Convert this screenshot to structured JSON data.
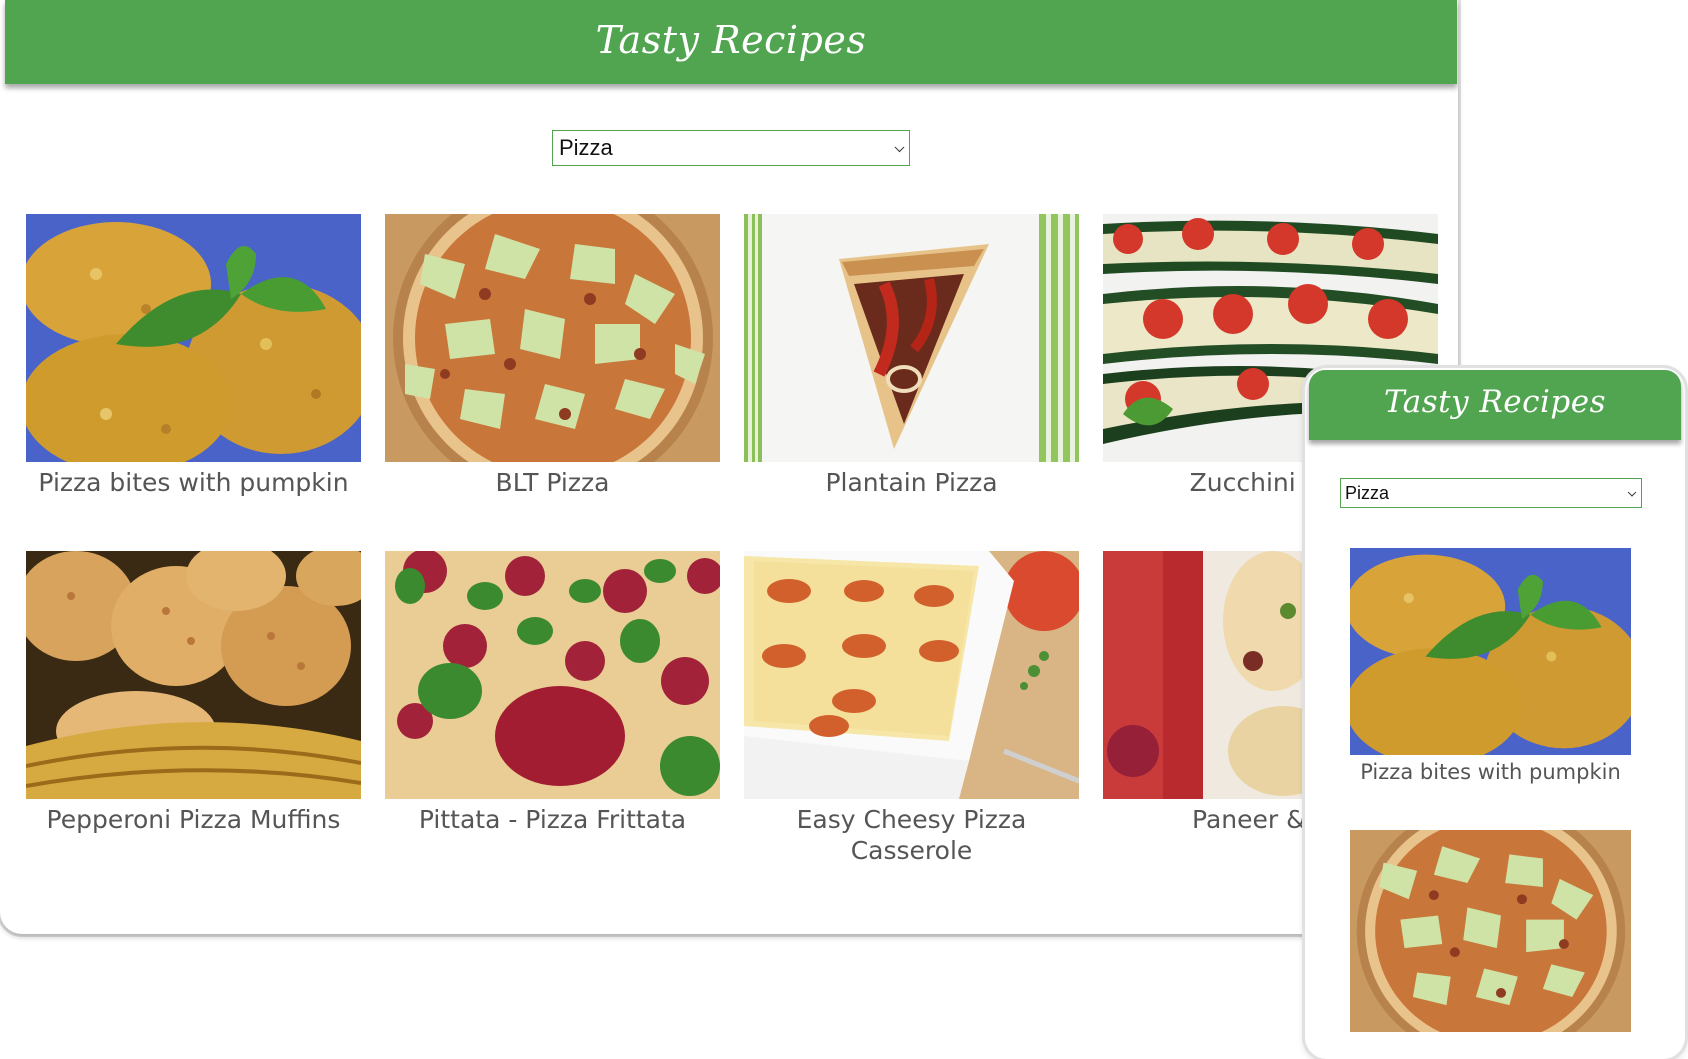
{
  "app": {
    "title": "Tasty Recipes"
  },
  "filter": {
    "selected": "Pizza"
  },
  "recipes": [
    {
      "title": "Pizza bites with pumpkin",
      "image": "pizza-bites-photo"
    },
    {
      "title": "BLT Pizza",
      "image": "blt-pizza-photo"
    },
    {
      "title": "Plantain Pizza",
      "image": "plantain-pizza-photo"
    },
    {
      "title": "Zucchini Pizz",
      "image": "zucchini-pizza-photo"
    },
    {
      "title": "Pepperoni Pizza Muffins",
      "image": "pepperoni-muffins-photo"
    },
    {
      "title": "Pittata - Pizza Frittata",
      "image": "pittata-photo"
    },
    {
      "title": "Easy Cheesy Pizza Casserole",
      "image": "casserole-photo"
    },
    {
      "title": "Paneer & Fig",
      "image": "paneer-fig-photo"
    }
  ],
  "colors": {
    "header": "#52a550",
    "card_text": "#555555"
  }
}
